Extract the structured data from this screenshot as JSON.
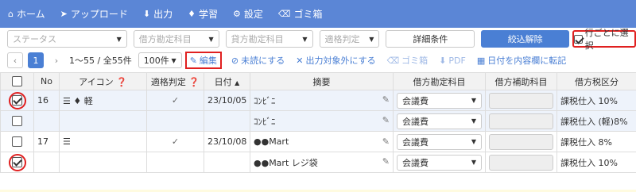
{
  "nav": {
    "items": [
      {
        "icon": "home-icon",
        "label": "ホーム"
      },
      {
        "icon": "send-icon",
        "label": "アップロード"
      },
      {
        "icon": "download-icon",
        "label": "出力"
      },
      {
        "icon": "graduation-cap-icon",
        "label": "学習"
      },
      {
        "icon": "gear-icon",
        "label": "設定"
      },
      {
        "icon": "trash-icon",
        "label": "ゴミ箱"
      }
    ]
  },
  "filters": {
    "status_placeholder": "ステータス",
    "debit_account_placeholder": "借方勘定科目",
    "credit_account_placeholder": "貸方勘定科目",
    "eligibility_placeholder": "適格判定",
    "detail_conditions": "詳細条件",
    "clear_filter": "絞込解除",
    "select_per_row": "行ごとに選択"
  },
  "toolbar": {
    "page_current": "1",
    "range": "1〜55 / 全55件",
    "per_page": "100件",
    "edit": "編集",
    "mark_unread": "未読にする",
    "exclude_output": "出力対象外にする",
    "trash": "ゴミ箱",
    "pdf": "PDF",
    "date_to_content": "日付を内容欄に転記"
  },
  "table": {
    "headers": {
      "no": "No",
      "icon": "アイコン",
      "eligibility": "適格判定",
      "date": "日付",
      "summary": "摘要",
      "debit_account": "借方勘定科目",
      "debit_sub": "借方補助科目",
      "debit_tax": "借方税区分"
    },
    "rows": [
      {
        "checked": true,
        "circled": true,
        "no": "16",
        "icon_text": "軽",
        "date": "23/10/05",
        "summary": "ｺﾝﾋﾞﾆ",
        "account": "会議費",
        "tax": "課税仕入 10%"
      },
      {
        "checked": false,
        "circled": false,
        "no": "",
        "icon_text": "",
        "date": "",
        "summary": "ｺﾝﾋﾞﾆ",
        "account": "会議費",
        "tax": "課税仕入 (軽)8%"
      },
      {
        "checked": false,
        "circled": false,
        "no": "17",
        "icon_text": "",
        "date": "23/10/08",
        "summary": "●●Mart",
        "account": "会議費",
        "tax": "課税仕入 8%"
      },
      {
        "checked": true,
        "circled": true,
        "no": "",
        "icon_text": "",
        "date": "",
        "summary": "●●Mart レジ袋",
        "account": "会議費",
        "tax": "課税仕入 10%"
      }
    ]
  }
}
